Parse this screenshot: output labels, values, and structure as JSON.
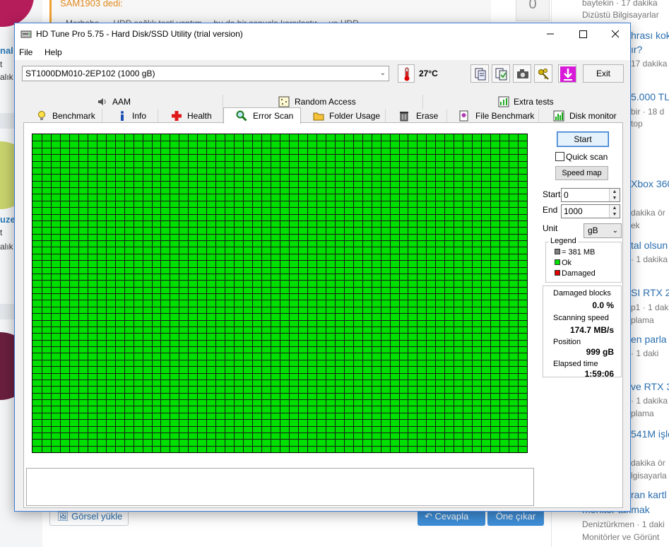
{
  "forum": {
    "quote_author": "SAM1903 dedi:",
    "quote_snippet": "Merhaba, ... HDD sağlık testi yaptım ... bu da bir sonuçla karşılaştır ... ve HDD ...",
    "reply_count": "0",
    "left_snippets": [
      "nal",
      "t",
      "alık",
      "uzel",
      "t",
      "alık"
    ],
    "upload_image_label": "Görsel yükle",
    "reply_label": "Cevapla",
    "promote_label": "Öne çıkar",
    "sidebar_lines": [
      "baytekin · 17 dakika",
      "Dizüstü Bilgisayarlar",
      "hrası kok",
      "ır?",
      "17 dakika",
      "5.000 TL",
      "bir · 18 d",
      "top",
      "Xbox 360",
      "dakika ör",
      "ek",
      "tal olsun",
      "· 1 dakika",
      "SI RTX 2",
      "p1 · 1 dak",
      "plama",
      "en parla",
      "· 1 daki",
      "ve RTX 3",
      "· 1 dakika",
      "plama",
      "541M işle",
      "dakika ör",
      "lgisayarla",
      "ran kartl",
      "monitör takmak",
      "Deniztürkmen · 1 daki",
      "Monitörler ve Görünt"
    ]
  },
  "window": {
    "title": "HD Tune Pro 5.75 - Hard Disk/SSD Utility (trial version)",
    "menu": [
      "File",
      "Help"
    ],
    "drive": "ST1000DM010-2EP102 (1000 gB)",
    "temperature": "27°C",
    "exit_label": "Exit",
    "tabs_top": [
      "AAM",
      "Random Access",
      "Extra tests"
    ],
    "tabs_bottom": [
      "Benchmark",
      "Info",
      "Health",
      "Error Scan",
      "Folder Usage",
      "Erase",
      "File Benchmark",
      "Disk monitor"
    ],
    "active_tab": "Error Scan"
  },
  "error_scan": {
    "start_label": "Start",
    "quick_scan_label": "Quick scan",
    "quick_scan_checked": false,
    "speed_map_label": "Speed map",
    "start_field_label": "Start",
    "start_value": "0",
    "end_field_label": "End",
    "end_value": "1000",
    "unit_label": "Unit",
    "unit_value": "gB",
    "legend_title": "Legend",
    "legend_block_size": "= 381 MB",
    "legend_ok": "Ok",
    "legend_damaged": "Damaged",
    "damaged_blocks_label": "Damaged blocks",
    "damaged_blocks_value": "0.0 %",
    "scanning_speed_label": "Scanning speed",
    "scanning_speed_value": "174.7 MB/s",
    "position_label": "Position",
    "position_value": "999 gB",
    "elapsed_label": "Elapsed time",
    "elapsed_value": "1:59:06",
    "colors": {
      "ok": "#00e000",
      "damaged": "#e00000",
      "block": "#808080"
    }
  }
}
